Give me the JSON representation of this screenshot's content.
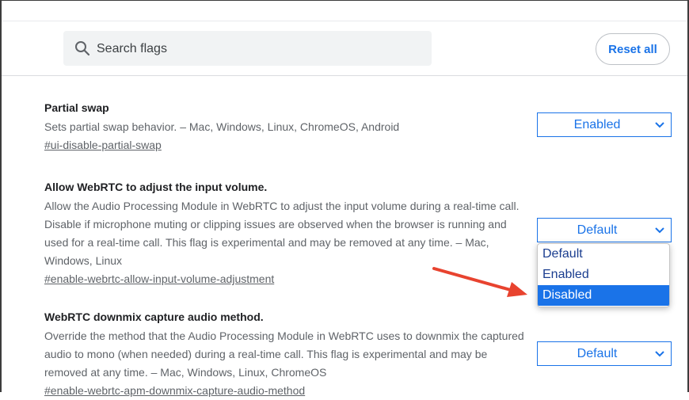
{
  "search": {
    "placeholder": "Search flags"
  },
  "toolbar": {
    "reset_label": "Reset all"
  },
  "flags": [
    {
      "title": "Partial swap",
      "description": "Sets partial swap behavior. – Mac, Windows, Linux, ChromeOS, Android",
      "link": "#ui-disable-partial-swap",
      "value": "Enabled"
    },
    {
      "title": "Allow WebRTC to adjust the input volume.",
      "description": "Allow the Audio Processing Module in WebRTC to adjust the input volume during a real-time call. Disable if microphone muting or clipping issues are observed when the browser is running and used for a real-time call. This flag is experimental and may be removed at any time. – Mac, Windows, Linux",
      "link": "#enable-webrtc-allow-input-volume-adjustment",
      "value": "Default"
    },
    {
      "title": "WebRTC downmix capture audio method.",
      "description": "Override the method that the Audio Processing Module in WebRTC uses to downmix the captured audio to mono (when needed) during a real-time call. This flag is experimental and may be removed at any time. – Mac, Windows, Linux, ChromeOS",
      "link": "#enable-webrtc-apm-downmix-capture-audio-method",
      "value": "Default"
    }
  ],
  "dropdown": {
    "options": [
      "Default",
      "Enabled",
      "Disabled"
    ],
    "highlighted": "Disabled"
  },
  "colors": {
    "accent": "#1a73e8",
    "arrow": "#e8432f"
  }
}
